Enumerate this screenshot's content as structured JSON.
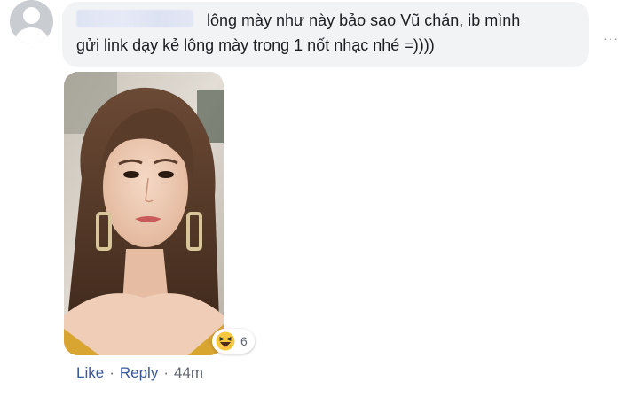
{
  "comment": {
    "text_line1": "lông mày như này bảo sao Vũ chán, ib mình",
    "text_line2": "gửi link dạy kẻ lông mày trong 1 nốt nhạc nhé =))))",
    "more_options": "···"
  },
  "reactions": {
    "icon": "haha-emoji-icon",
    "count": "6"
  },
  "actions": {
    "like": "Like",
    "separator": "·",
    "reply": "Reply",
    "timestamp": "44m"
  },
  "colors": {
    "bubble": "#f2f3f5",
    "link": "#385898",
    "meta": "#606770",
    "text": "#1c1e21"
  }
}
